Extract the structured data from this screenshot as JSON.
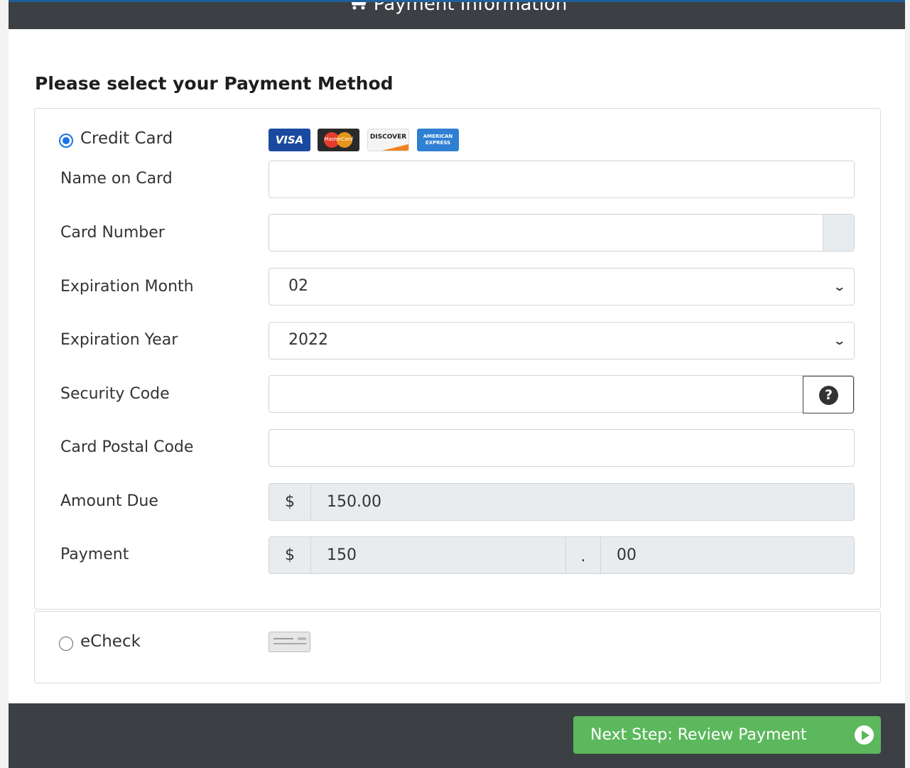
{
  "header": {
    "title": "Payment Information",
    "icon": "cart-icon"
  },
  "section_title": "Please select your Payment Method",
  "credit_card": {
    "label": "Credit Card",
    "selected": true,
    "card_logos": [
      {
        "name": "visa-logo",
        "text": "VISA"
      },
      {
        "name": "mastercard-logo",
        "text": "MasterCard"
      },
      {
        "name": "discover-logo",
        "text": "DISCOVER"
      },
      {
        "name": "amex-logo",
        "text": "AMERICAN EXPRESS"
      }
    ],
    "fields": {
      "name_on_card": {
        "label": "Name on Card",
        "value": ""
      },
      "card_number": {
        "label": "Card Number",
        "value": ""
      },
      "expiration_month": {
        "label": "Expiration Month",
        "value": "02"
      },
      "expiration_year": {
        "label": "Expiration Year",
        "value": "2022"
      },
      "security_code": {
        "label": "Security Code",
        "value": "",
        "help_icon": "question-circle-icon"
      },
      "card_postal_code": {
        "label": "Card Postal Code",
        "value": ""
      },
      "amount_due": {
        "label": "Amount Due",
        "currency": "$",
        "value": "150.00"
      },
      "payment": {
        "label": "Payment",
        "currency": "$",
        "dollars": "150",
        "separator": ".",
        "cents": "00"
      }
    }
  },
  "echeck": {
    "label": "eCheck",
    "selected": false,
    "icon": "check-image-icon"
  },
  "footer": {
    "next_button_label": "Next Step: Review Payment",
    "next_icon": "play-circle-icon",
    "button_color": "#5cb85c"
  },
  "colors": {
    "header_bg": "#3c3f44",
    "radio_accent": "#1a73e8"
  }
}
